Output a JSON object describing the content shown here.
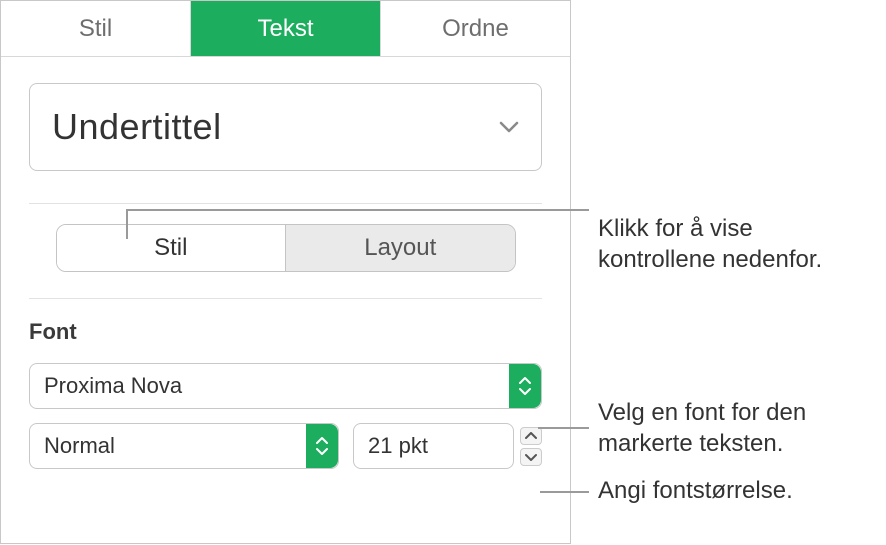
{
  "tabs": {
    "stil": "Stil",
    "tekst": "Tekst",
    "ordne": "Ordne"
  },
  "paragraphStyle": {
    "label": "Undertittel"
  },
  "segmented": {
    "stil": "Stil",
    "layout": "Layout"
  },
  "font": {
    "section_label": "Font",
    "family": "Proxima Nova",
    "style": "Normal",
    "size": "21 pkt"
  },
  "annotations": {
    "a1_line1": "Klikk for å vise",
    "a1_line2": "kontrollene nedenfor.",
    "a2_line1": "Velg en font for den",
    "a2_line2": "markerte teksten.",
    "a3": "Angi fontstørrelse."
  }
}
